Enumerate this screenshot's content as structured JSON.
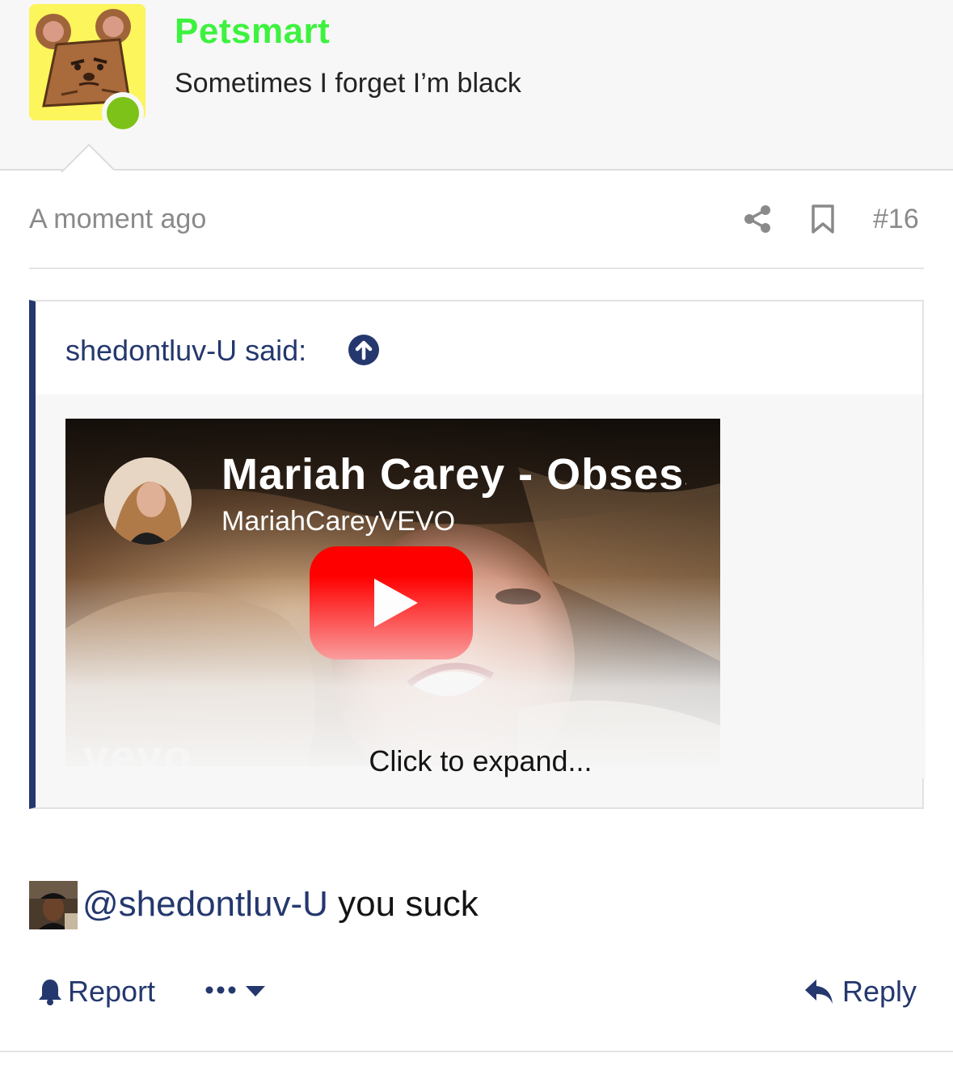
{
  "user": {
    "name": "Petsmart",
    "title": "Sometimes I forget I’m black",
    "name_color": "#3df23f",
    "avatar_bg": "#fcf55b",
    "online_color": "#7cc218"
  },
  "meta": {
    "time": "A moment ago",
    "post_number": "#16"
  },
  "quote": {
    "author_line": "shedontluv-U said:",
    "video": {
      "title": "Mariah Carey - Obsessed",
      "channel": "MariahCareyVEVO",
      "watermark": "vevo"
    },
    "expand_label": "Click to expand..."
  },
  "message": {
    "mention": "@shedontluv-U",
    "text": " you suck"
  },
  "actions": {
    "report_label": "Report",
    "reply_label": "Reply"
  },
  "colors": {
    "link": "#24386e",
    "muted": "#8a8a8a",
    "quote_bar": "#24386e"
  }
}
